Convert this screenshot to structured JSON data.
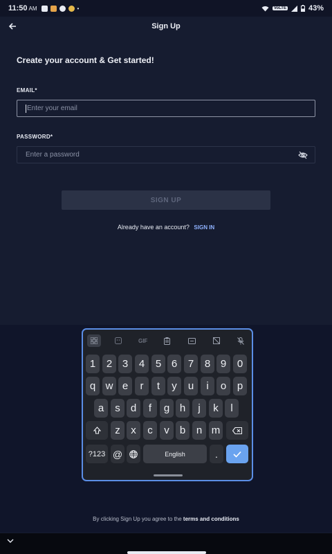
{
  "status_bar": {
    "time": "11:50",
    "ampm": "AM",
    "network_badge": "VoLTE",
    "battery": "43%",
    "colors": {
      "app1": "#e8ebf3",
      "app2": "#e6a44a",
      "app3": "#e8ebf3",
      "app4": "#e5b84a"
    }
  },
  "header": {
    "back_icon": "arrow-left-icon",
    "title": "Sign Up"
  },
  "form": {
    "headline": "Create your account & Get started!",
    "email_label": "EMAIL*",
    "email_placeholder": "Enter your email",
    "password_label": "PASSWORD*",
    "password_placeholder": "Enter a password",
    "visibility_icon": "eye-off-icon",
    "submit_label": "SIGN UP"
  },
  "signin": {
    "prompt": "Already have an account?",
    "link": "SIGN IN"
  },
  "keyboard": {
    "toolbar": [
      "apps-grid-icon",
      "sticker-icon",
      "GIF",
      "clipboard-icon",
      "text-edit-icon",
      "no-image-icon",
      "mic-off-icon"
    ],
    "row1": [
      "1",
      "2",
      "3",
      "4",
      "5",
      "6",
      "7",
      "8",
      "9",
      "0"
    ],
    "row2": [
      "q",
      "w",
      "e",
      "r",
      "t",
      "y",
      "u",
      "i",
      "o",
      "p"
    ],
    "row3": [
      "a",
      "s",
      "d",
      "f",
      "g",
      "h",
      "j",
      "k",
      "l"
    ],
    "row4": [
      "z",
      "x",
      "c",
      "v",
      "b",
      "n",
      "m"
    ],
    "shift_icon": "shift-icon",
    "backspace_icon": "backspace-icon",
    "symbols_label": "?123",
    "at_label": "@",
    "globe_icon": "globe-icon",
    "space_label": "English",
    "period_label": ".",
    "enter_icon": "check-icon"
  },
  "footer": {
    "terms_prefix": "By clicking Sign Up you agree to the",
    "terms_link": "terms and conditions"
  },
  "nav": {
    "collapse_icon": "chevron-down-icon"
  },
  "colors": {
    "background": "#161c30",
    "accent_link": "#8fb2ff",
    "keyboard_border": "#5b8ee6",
    "enter_key": "#6aa3ef"
  }
}
